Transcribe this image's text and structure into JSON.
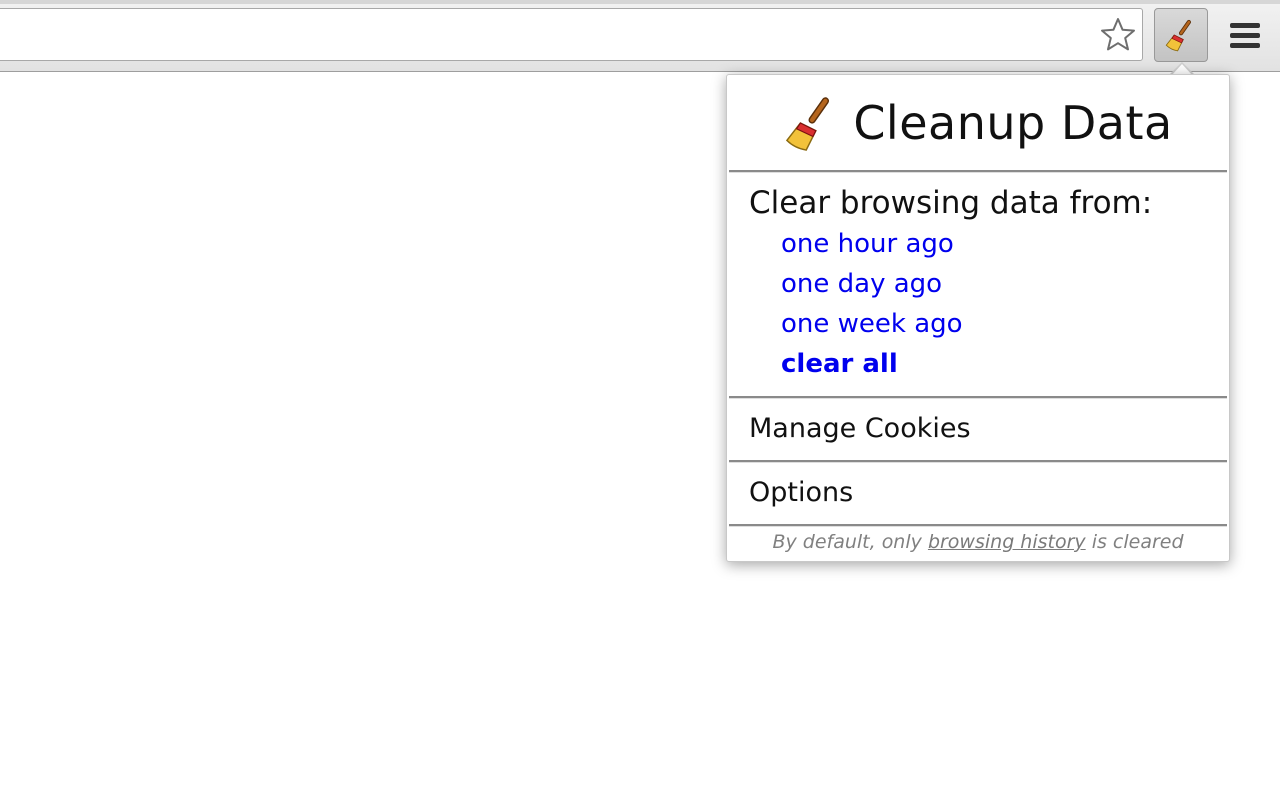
{
  "browser": {
    "star_icon": "star-outline-icon",
    "extension_icon": "broom-icon",
    "menu_icon": "hamburger-menu-icon"
  },
  "popup": {
    "title": "Cleanup Data",
    "title_icon": "broom-icon",
    "section_label": "Clear browsing data from:",
    "ranges": [
      {
        "label": "one hour ago",
        "bold": false
      },
      {
        "label": "one day ago",
        "bold": false
      },
      {
        "label": "one week ago",
        "bold": false
      },
      {
        "label": "clear all",
        "bold": true
      }
    ],
    "manage_cookies": "Manage Cookies",
    "options": "Options",
    "footnote": {
      "prefix": "By default, only",
      "link": "browsing history",
      "suffix": "is cleared"
    }
  },
  "colors": {
    "link": "#0000ee",
    "text": "#111111",
    "footnote": "#808080"
  }
}
